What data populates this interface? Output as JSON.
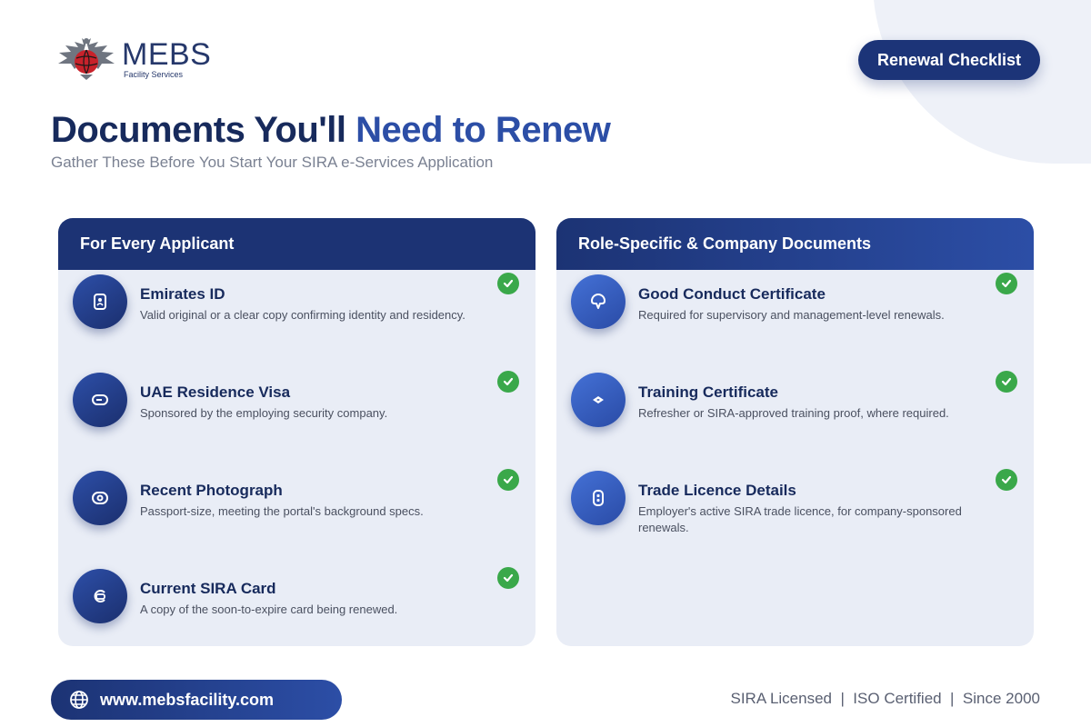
{
  "brand": {
    "name": "MEBS",
    "tagline": "Facility Services"
  },
  "header": {
    "badge_label": "Renewal Checklist",
    "title_part1": "Documents You'll ",
    "title_part2": "Need to Renew",
    "subtitle": "Gather These Before You Start Your SIRA e-Services Application"
  },
  "cards": [
    {
      "heading": "For Every Applicant",
      "items": [
        {
          "title": "Emirates ID",
          "desc": "Valid original or a clear copy confirming identity and residency.",
          "icon": "id-card-icon",
          "checked": true
        },
        {
          "title": "UAE Residence Visa",
          "desc": "Sponsored by the employing security company.",
          "icon": "visa-icon",
          "checked": true
        },
        {
          "title": "Recent Photograph",
          "desc": "Passport-size, meeting the portal's background specs.",
          "icon": "camera-icon",
          "checked": true
        },
        {
          "title": "Current SIRA Card",
          "desc": "A copy of the soon-to-expire card being renewed.",
          "icon": "card-icon",
          "checked": true
        }
      ]
    },
    {
      "heading": "Role-Specific & Company Documents",
      "items": [
        {
          "title": "Good Conduct Certificate",
          "desc": "Required for supervisory and management-level renewals.",
          "icon": "badge-icon",
          "checked": true
        },
        {
          "title": "Training Certificate",
          "desc": "Refresher or SIRA-approved training proof, where required.",
          "icon": "graduation-cap-icon",
          "checked": true
        },
        {
          "title": "Trade Licence Details",
          "desc": "Employer's active SIRA trade licence, for company-sponsored renewals.",
          "icon": "document-icon",
          "checked": true
        }
      ]
    }
  ],
  "footer": {
    "website": "www.mebsfacility.com",
    "credentials": "SIRA Licensed  |  ISO Certified  |  Since 2000"
  },
  "colors": {
    "navy": "#1c3374",
    "accent_blue": "#2c4ea6",
    "check_green": "#3aa84a",
    "card_bg": "#e9edf6"
  }
}
